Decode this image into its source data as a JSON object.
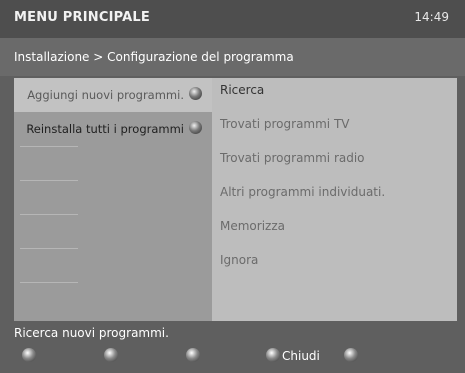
{
  "header": {
    "title": "MENU PRINCIPALE",
    "time": "14:49"
  },
  "breadcrumb": "Installazione > Configurazione del programma",
  "left_menu": [
    {
      "label": "Aggiungi nuovi programmi.",
      "selected": true
    },
    {
      "label": "Reinstalla tutti i programmi",
      "selected": false
    }
  ],
  "right_menu": [
    {
      "label": "Ricerca"
    },
    {
      "label": "Trovati programmi TV"
    },
    {
      "label": "Trovati programmi radio"
    },
    {
      "label": "Altri programmi individuati."
    },
    {
      "label": "Memorizza"
    },
    {
      "label": "Ignora"
    }
  ],
  "status": "Ricerca nuovi programmi.",
  "buttons": {
    "close_label": "Chiudi"
  }
}
